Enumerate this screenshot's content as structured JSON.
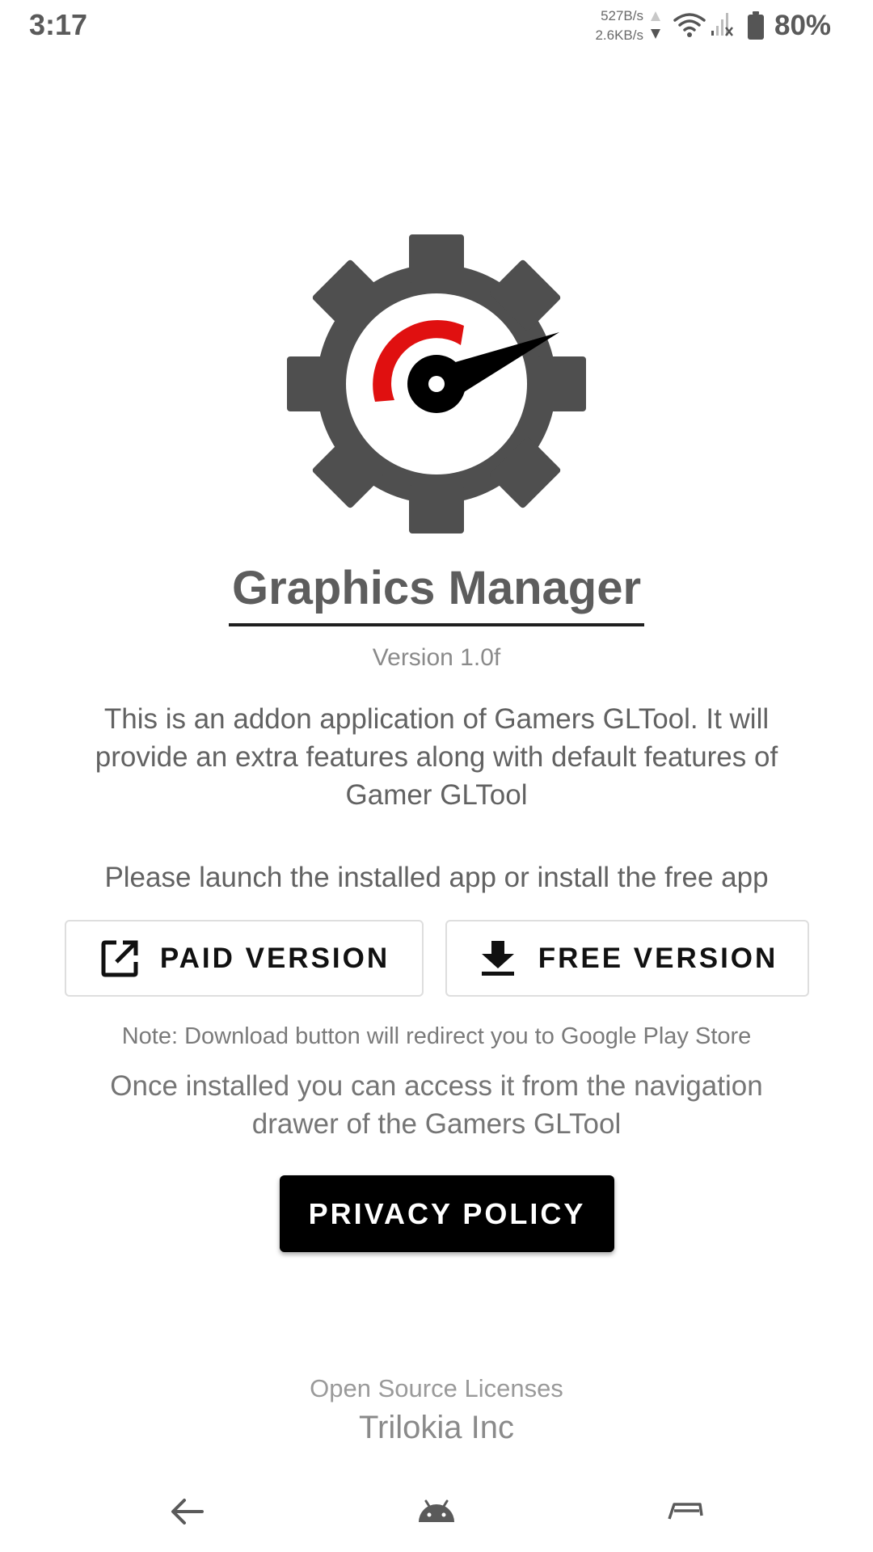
{
  "status_bar": {
    "time": "3:17",
    "upload_speed": "527B/s",
    "download_speed": "2.6KB/s",
    "battery": "80%",
    "icons": [
      "net-activity-icon",
      "wifi-icon",
      "no-signal-icon",
      "battery-icon"
    ]
  },
  "app": {
    "title": "Graphics Manager",
    "version": "Version 1.0f",
    "description": "This is an addon application of Gamers GLTool. It will provide an extra features along with default features of Gamer GLTool",
    "logo_icon": "gear-speedometer-logo"
  },
  "launch": {
    "prompt": "Please launch the installed app or install the free app",
    "paid_label": "PAID VERSION",
    "paid_icon": "open-external-icon",
    "free_label": "FREE VERSION",
    "free_icon": "download-icon"
  },
  "note": "Note: Download button will redirect you to Google Play Store",
  "access_info": "Once installed you can access it from the navigation drawer of the Gamers GLTool",
  "privacy_label": "PRIVACY POLICY",
  "footer": {
    "licenses": "Open Source Licenses",
    "company": "Trilokia Inc"
  },
  "nav": {
    "icons": [
      "back-arrow-icon",
      "android-home-icon",
      "recents-icon"
    ]
  },
  "colors": {
    "gear": "#4f4f4f",
    "accent_red": "#e01010",
    "primary_button": "#000000"
  }
}
